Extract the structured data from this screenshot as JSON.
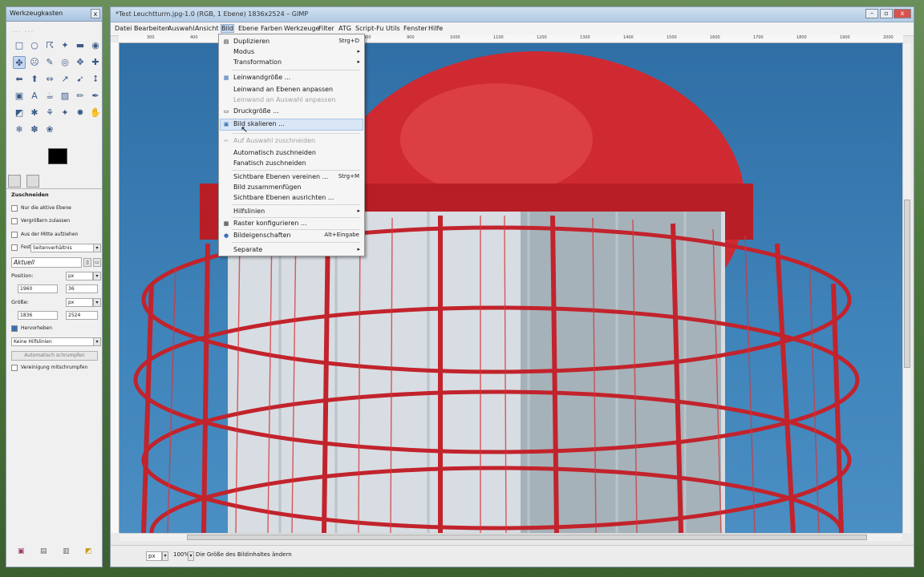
{
  "toolbox": {
    "title": "Werkzeugkasten",
    "close": "x",
    "logo": "… …",
    "tools": [
      "□",
      "○",
      "☈",
      "✦",
      "▬",
      "◉",
      "✤",
      "☹",
      "✎",
      "◎",
      "✥",
      "✚",
      "⬅",
      "⬆",
      "⇔",
      "↗",
      "➹",
      "⭥",
      "▣",
      "A",
      "☕",
      "▨",
      "✏",
      "✒",
      "◩",
      "✱",
      "⚘",
      "✦",
      "✹",
      "✋",
      "❄",
      "✽",
      "❀"
    ],
    "options_title": "Zuschneiden",
    "opt_active_layer": "Nur die aktive Ebene",
    "opt_grow": "Vergrößern zulassen",
    "opt_center": "Aus der Mitte aufziehen",
    "opt_fixed": "Fest",
    "opt_fixed_value": "Seitenverhältnis",
    "aspect_value": "Aktuell",
    "position_label": "Position:",
    "position_unit": "px",
    "pos_x": "1960",
    "pos_y": "36",
    "size_label": "Größe:",
    "size_unit": "px",
    "size_w": "1836",
    "size_h": "2524",
    "highlight": "Hervorheben",
    "guides": "Keine Hilfslinien",
    "autoshrink": "Automatisch schrumpfen",
    "shrink_merged": "Vereinigung mitschrumpfen"
  },
  "main": {
    "title": "*Test Leuchtturm.jpg-1.0 (RGB, 1 Ebene) 1836x2524 – GIMP",
    "menus": [
      "Datei",
      "Bearbeiten",
      "Auswahl",
      "Ansicht",
      "Bild",
      "Ebene",
      "Farben",
      "Werkzeuge",
      "Filter",
      "ATG",
      "Script-Fu",
      "Utils",
      "Fenster",
      "Hilfe"
    ],
    "ruler_ticks": [
      "300",
      "400",
      "500",
      "600",
      "700",
      "800",
      "900",
      "1000",
      "1100",
      "1200",
      "1300",
      "1400",
      "1500",
      "1600",
      "1700",
      "1800",
      "1900",
      "2000"
    ],
    "unit": "px",
    "zoom": "100%",
    "status": "Die Größe des Bildinhaltes ändern"
  },
  "bild_menu": {
    "items": [
      {
        "label": "Duplizieren",
        "shortcut": "Strg+D"
      },
      {
        "label": "Modus",
        "arrow": "▸"
      },
      {
        "label": "Transformation",
        "arrow": "▸"
      },
      {
        "label": "Leinwandgröße ..."
      },
      {
        "label": "Leinwand an Ebenen anpassen"
      },
      {
        "label": "Leinwand an Auswahl anpassen"
      },
      {
        "label": "Druckgröße ..."
      },
      {
        "label": "Bild skalieren ..."
      },
      {
        "label": "Auf Auswahl zuschneiden"
      },
      {
        "label": "Automatisch zuschneiden"
      },
      {
        "label": "Fanatisch zuschneiden"
      },
      {
        "label": "Sichtbare Ebenen vereinen ...",
        "shortcut": "Strg+M"
      },
      {
        "label": "Bild zusammenfügen"
      },
      {
        "label": "Sichtbare Ebenen ausrichten ..."
      },
      {
        "label": "Hilfslinien",
        "arrow": "▸"
      },
      {
        "label": "Raster konfigurieren ..."
      },
      {
        "label": "Bildeigenschaften",
        "shortcut": "Alt+Eingabe"
      },
      {
        "label": "Separate",
        "arrow": "▸"
      }
    ]
  },
  "colors": {
    "sky": "#3a7eb6",
    "lighthouse_red": "#d2262e",
    "menu_highlight": "#d9e6f5"
  }
}
